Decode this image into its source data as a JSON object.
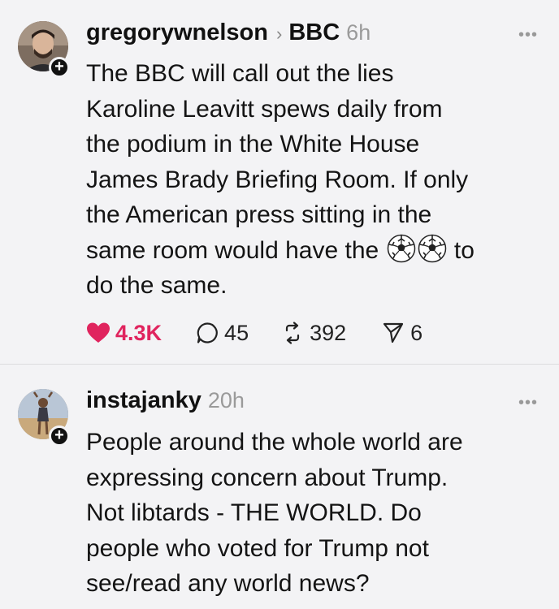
{
  "posts": [
    {
      "username": "gregorywnelson",
      "community": "BBC",
      "time": "6h",
      "more_icon": "more-dots-icon",
      "lines": [
        "The BBC will call out the lies",
        "Karoline Leavitt spews daily from",
        "the podium in the White House",
        "James Brady Briefing Room. If only",
        "the American press sitting in the",
        "same room would have the",
        "to",
        "do the same."
      ],
      "stats": {
        "likes": "4.3K",
        "replies": "45",
        "reposts": "392",
        "shares": "6"
      }
    },
    {
      "username": "instajanky",
      "time": "20h",
      "more_icon": "more-dots-icon",
      "lines": [
        "People around the whole world are",
        "expressing concern about Trump.",
        "Not libtards - THE WORLD. Do",
        "people who voted for Trump not",
        "see/read any world news?"
      ]
    }
  ],
  "colors": {
    "like": "#e0245e",
    "background": "#f3f3f5",
    "muted": "#9a9a9a"
  }
}
